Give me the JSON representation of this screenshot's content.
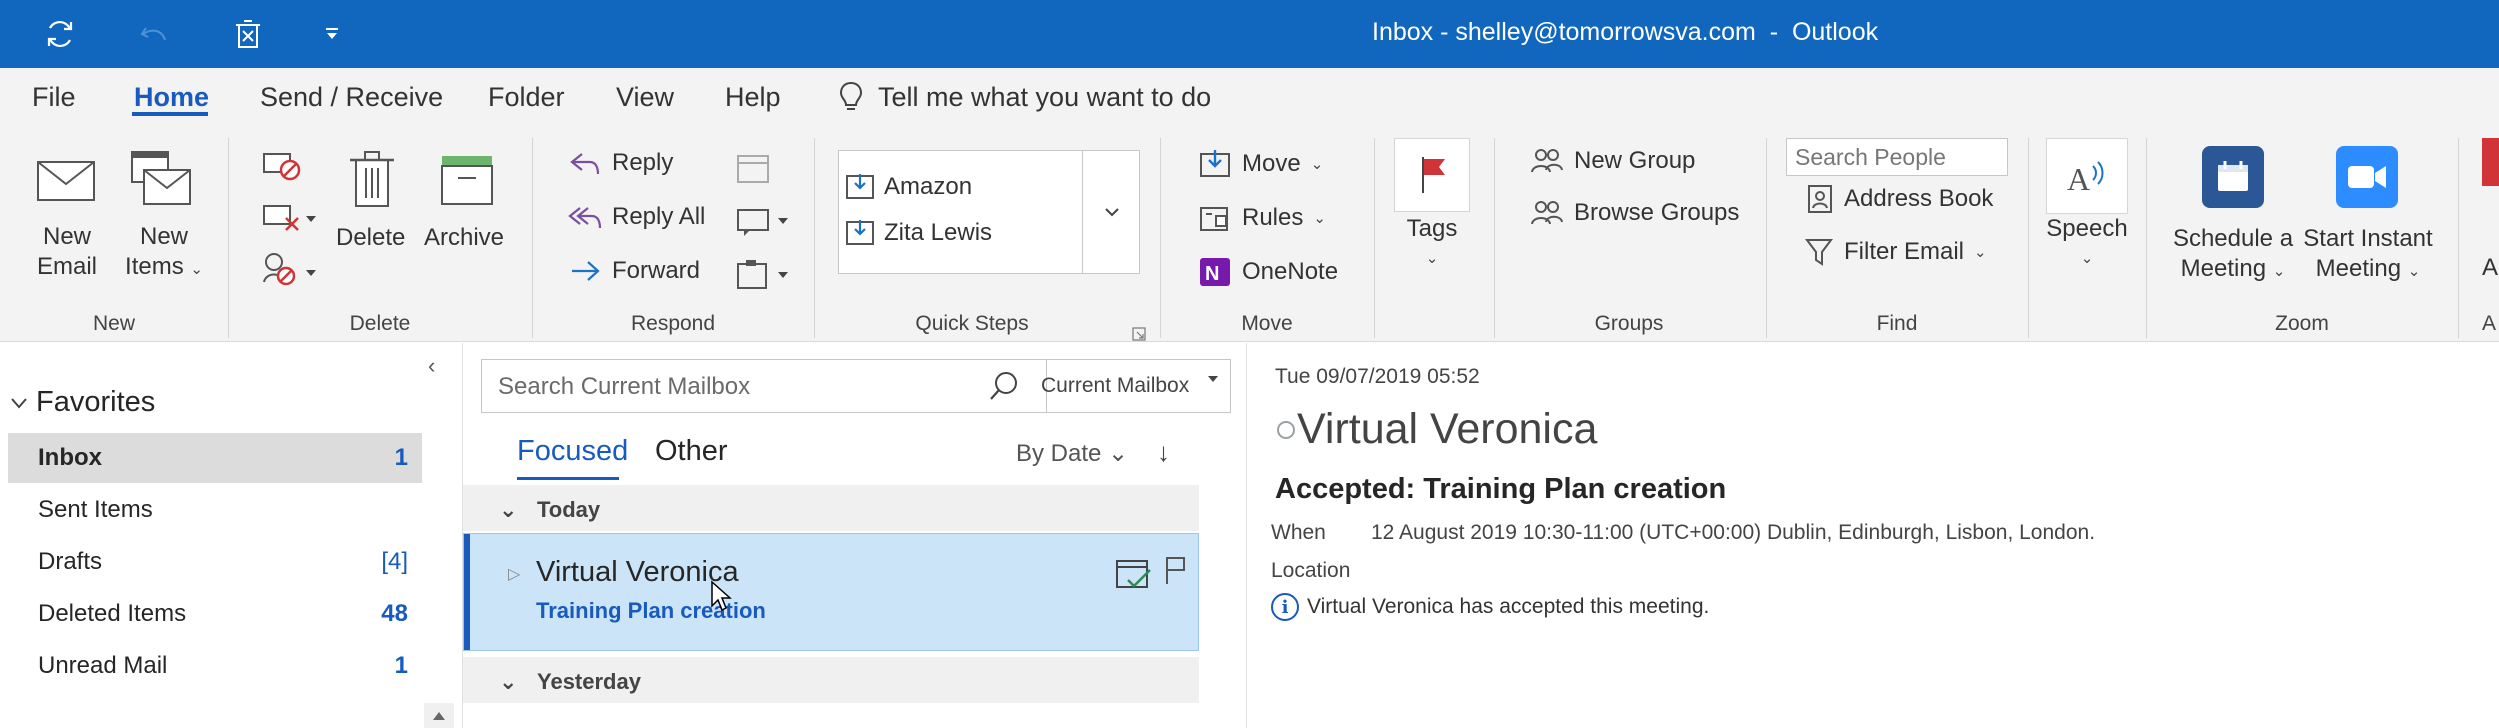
{
  "window": {
    "title": "Inbox - shelley@tomorrowsva.com  -  Outlook"
  },
  "colors": {
    "accent": "#185abd",
    "titlebar": "#1167bd",
    "selected_mail": "#cce4f7",
    "flag": "#d13438",
    "onenote": "#7719aa",
    "zoom": "#2d8cff",
    "schedule": "#2b5797"
  },
  "qat": {
    "icons": [
      "sync-icon",
      "undo-icon",
      "delete-icon",
      "customize-icon"
    ]
  },
  "tabs": [
    "File",
    "Home",
    "Send / Receive",
    "Folder",
    "View",
    "Help"
  ],
  "active_tab": "Home",
  "tell_me": "Tell me what you want to do",
  "ribbon": {
    "new_group": {
      "label": "New",
      "new_email": [
        "New",
        "Email"
      ],
      "new_items": [
        "New",
        "Items"
      ]
    },
    "delete_group": {
      "label": "Delete",
      "delete": "Delete",
      "archive": "Archive"
    },
    "respond_group": {
      "label": "Respond",
      "reply": "Reply",
      "reply_all": "Reply All",
      "forward": "Forward"
    },
    "quicksteps_group": {
      "label": "Quick Steps",
      "items": [
        "Amazon",
        "Zita Lewis"
      ]
    },
    "move_group": {
      "label": "Move",
      "move": "Move",
      "rules": "Rules",
      "onenote": "OneNote"
    },
    "tags_group": {
      "tags": "Tags"
    },
    "groups_group": {
      "label": "Groups",
      "new_group": "New Group",
      "browse_groups": "Browse Groups"
    },
    "find_group": {
      "label": "Find",
      "search_people": "Search People",
      "address_book": "Address Book",
      "filter_email": "Filter Email"
    },
    "speech_group": {
      "speech": "Speech"
    },
    "zoom_group": {
      "label": "Zoom",
      "schedule": [
        "Schedule a",
        "Meeting"
      ],
      "instant": [
        "Start Instant",
        "Meeting"
      ],
      "cut_label": "A"
    }
  },
  "folders": {
    "header": "Favorites",
    "items": [
      {
        "name": "Inbox",
        "count": "1"
      },
      {
        "name": "Sent Items",
        "count": ""
      },
      {
        "name": "Drafts",
        "count": "[4]"
      },
      {
        "name": "Deleted Items",
        "count": "48"
      },
      {
        "name": "Unread Mail",
        "count": "1"
      }
    ]
  },
  "message_list": {
    "search_placeholder": "Search Current Mailbox",
    "search_scope": "Current Mailbox",
    "tabs": [
      "Focused",
      "Other"
    ],
    "sort_by": "By Date",
    "sections": [
      "Today",
      "Yesterday"
    ],
    "selected_mail": {
      "sender": "Virtual Veronica",
      "subject": "Training Plan creation"
    }
  },
  "reading_pane": {
    "date": "Tue 09/07/2019 05:52",
    "sender": "Virtual Veronica",
    "subject": "Accepted: Training Plan creation",
    "when_label": "When",
    "when_value": "12 August 2019 10:30-11:00 (UTC+00:00) Dublin, Edinburgh, Lisbon, London.",
    "location_label": "Location",
    "info": "Virtual Veronica has accepted this meeting."
  }
}
